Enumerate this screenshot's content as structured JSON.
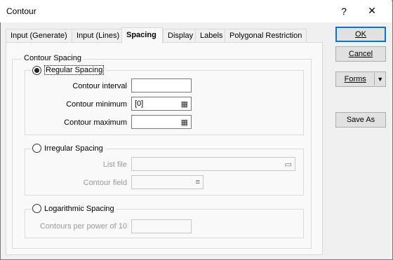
{
  "window": {
    "title": "Contour",
    "help_glyph": "?",
    "close_glyph": "✕"
  },
  "tabs": [
    {
      "label": "Input (Generate)"
    },
    {
      "label": "Input (Lines)"
    },
    {
      "label": "Spacing",
      "active": true
    },
    {
      "label": "Display"
    },
    {
      "label": "Labels"
    },
    {
      "label": "Polygonal Restriction"
    }
  ],
  "spacing": {
    "group_label": "Contour Spacing",
    "regular": {
      "label": "Regular Spacing",
      "selected": true,
      "interval_label": "Contour interval",
      "interval_value": "",
      "minimum_label": "Contour minimum",
      "minimum_value": "[0]",
      "maximum_label": "Contour maximum",
      "maximum_value": ""
    },
    "irregular": {
      "label": "Irregular Spacing",
      "selected": false,
      "list_file_label": "List file",
      "list_file_value": "",
      "contour_field_label": "Contour field",
      "contour_field_value": ""
    },
    "logarithmic": {
      "label": "Logarithmic Spacing",
      "selected": false,
      "per_power_label": "Contours per power of 10",
      "per_power_value": ""
    }
  },
  "buttons": {
    "ok": "OK",
    "cancel": "Cancel",
    "forms": "Forms",
    "save_as": "Save As"
  },
  "icons": {
    "calculator": "calculator-icon",
    "browse": "folder-browse-icon",
    "list": "list-icon",
    "dropdown": "dropdown-arrow-icon"
  }
}
